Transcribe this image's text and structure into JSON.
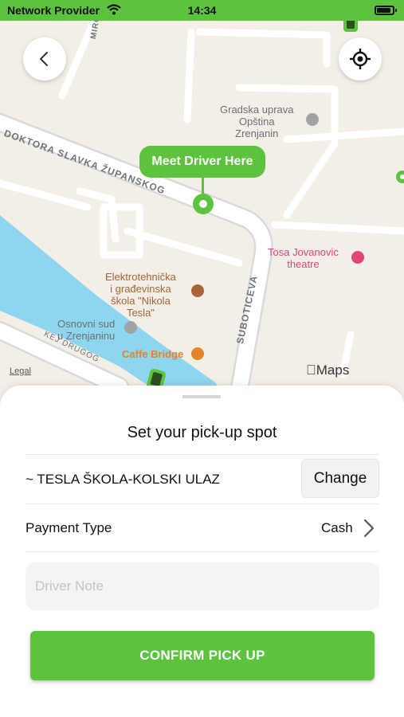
{
  "status_bar": {
    "carrier": "Network Provider",
    "time": "14:34",
    "battery_level": 0.9,
    "bar_color": "#5dc33f"
  },
  "map": {
    "streets": {
      "doktora": "DOKTORA SLAVKA ŽUPANSKOG",
      "suboticeva": "SUBOTICEVA",
      "kej": "KEJ DRUGOG",
      "mirc": "MIRC"
    },
    "places": {
      "gradska": "Gradska uprava\nOpština\nZrenjanin",
      "tosa": "Tosa Jovanovic\ntheatre",
      "skola": "Elektrotehnička\ni građevinska\nškola \"Nikola\nTesla\"",
      "sud": "Osnovni sud\nu Zrenjaninu",
      "caffe": "Caffe Bridge"
    },
    "pin_label": "Meet Driver Here",
    "legal": "Legal",
    "maps_logo": "Maps",
    "back_icon": "chevron-left-icon",
    "locate_icon": "crosshair-icon",
    "water_color": "#8ed6f0",
    "accent": "#5dc33f"
  },
  "sheet": {
    "title": "Set your pick-up spot",
    "spot": "~ TESLA ŠKOLA-KOLSKI ULAZ",
    "change_label": "Change",
    "payment_label": "Payment Type",
    "payment_value": "Cash",
    "note_placeholder": "Driver Note",
    "note_value": "",
    "confirm_label": "CONFIRM PICK UP"
  }
}
